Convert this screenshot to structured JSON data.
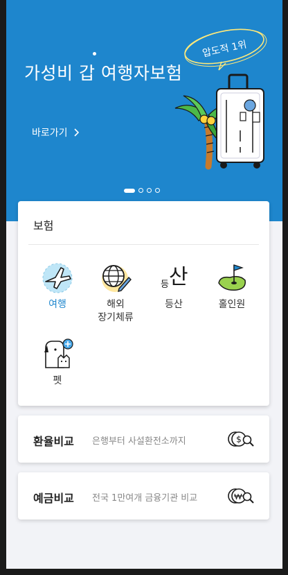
{
  "hero": {
    "title": "가성비 갑 여행자보험",
    "badge": "압도적 1위",
    "link_label": "바로가기",
    "pager": {
      "count": 4,
      "active_index": 0
    }
  },
  "insurance": {
    "title": "보험",
    "items": [
      {
        "label": "여행",
        "icon": "airplane-icon",
        "active": true
      },
      {
        "label": "해외\n장기체류",
        "icon": "globe-pen-icon",
        "active": false
      },
      {
        "label": "등산",
        "icon": "mountain-icon",
        "active": false
      },
      {
        "label": "홀인원",
        "icon": "golf-flag-icon",
        "active": false
      },
      {
        "label": "펫",
        "icon": "pet-icon",
        "active": false
      }
    ]
  },
  "exchange": {
    "title": "환율비교",
    "desc": "은행부터 사설환전소까지",
    "icon": "dollar-coin-search-icon"
  },
  "deposit": {
    "title": "예금비교",
    "desc": "전국 1만여개 금융기관 비교",
    "icon": "won-coin-search-icon"
  },
  "colors": {
    "primary": "#1e86cd",
    "background": "#f2f3f7",
    "frame": "#1a1a1a"
  }
}
